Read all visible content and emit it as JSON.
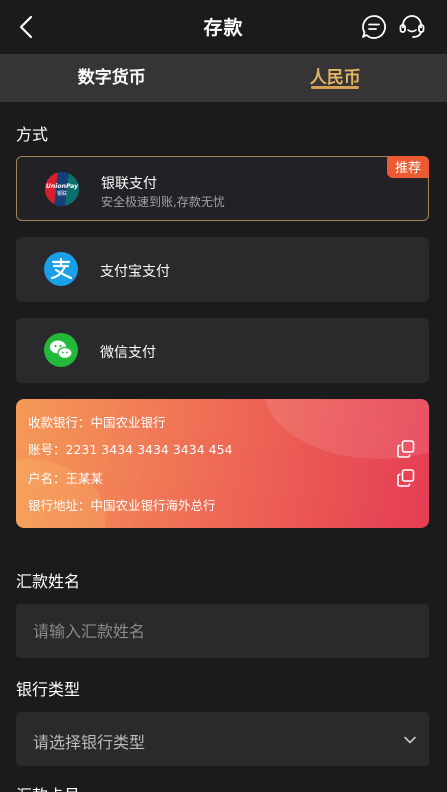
{
  "header": {
    "title": "存款"
  },
  "tabs": [
    {
      "label": "数字货币",
      "active": false
    },
    {
      "label": "人民币",
      "active": true
    }
  ],
  "method_label": "方式",
  "methods": [
    {
      "name": "银联支付",
      "subtitle": "安全极速到账,存款无忧",
      "badge": "推荐",
      "icon": "unionpay-icon",
      "selected": true
    },
    {
      "name": "支付宝支付",
      "icon": "alipay-icon",
      "selected": false
    },
    {
      "name": "微信支付",
      "icon": "wechat-icon",
      "selected": false
    }
  ],
  "bank_card": {
    "receiving_bank": "收款银行：中国农业银行",
    "account": "账号：2231 3434 3434 3434 454",
    "holder": "户名：王某某",
    "address": "银行地址：中国农业银行海外总行"
  },
  "remitter_name": {
    "label": "汇款姓名",
    "placeholder": "请输入汇款姓名"
  },
  "bank_type": {
    "label": "银行类型",
    "placeholder": "请选择银行类型"
  },
  "next_label": "汇款卡号",
  "colors": {
    "accent": "#e3b563",
    "badge": "#eb5a32",
    "background": "#1b1b1d"
  }
}
